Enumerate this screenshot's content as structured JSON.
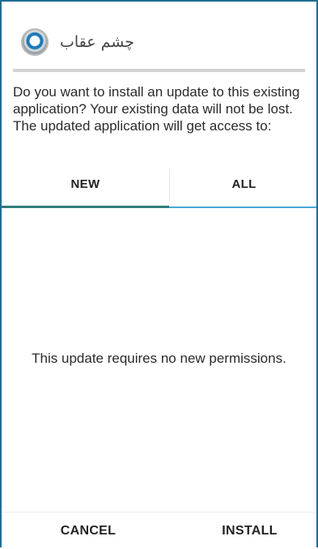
{
  "dialog": {
    "app_name": "چشم عقاب",
    "app_icon": "eagle-logo-icon",
    "message": "Do you want to install an update to this existing application? Your existing data will not be lost. The updated application will get access to:"
  },
  "tabs": {
    "new_label": "NEW",
    "all_label": "ALL",
    "active": "NEW"
  },
  "content": {
    "empty_text": "This update requires no new permissions."
  },
  "actions": {
    "cancel_label": "CANCEL",
    "install_label": "INSTALL"
  },
  "colors": {
    "active_tab_indicator": "#2e7d77",
    "inactive_tab_indicator": "#4aa7d6",
    "frame_border": "#1f6f92"
  }
}
